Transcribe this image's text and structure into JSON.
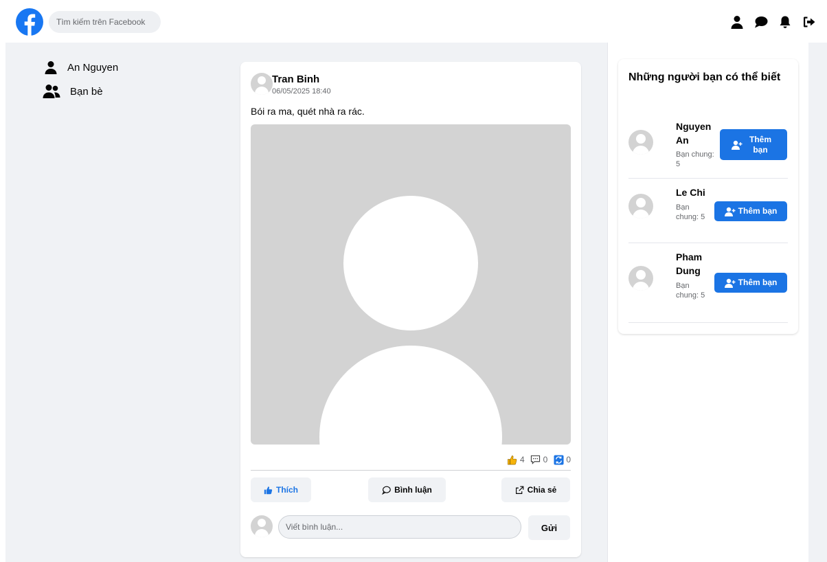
{
  "header": {
    "search_placeholder": "Tìm kiếm trên Facebook",
    "icons": [
      "profile-icon",
      "messenger-icon",
      "bell-icon",
      "logout-icon"
    ],
    "brand_color": "#1877f2"
  },
  "sidebar": {
    "items": [
      {
        "label": "An Nguyen",
        "icon": "user-icon"
      },
      {
        "label": "Bạn bè",
        "icon": "friends-icon"
      }
    ]
  },
  "post": {
    "author": "Tran Binh",
    "time": "06/05/2025 18:40",
    "text": "Bói ra ma, quét nhà ra rác.",
    "likes": "4",
    "comments": "0",
    "shares": "0",
    "like_label": "Thích",
    "comment_label": "Bình luận",
    "share_label": "Chia sẻ",
    "comment_placeholder": "Viết bình luận...",
    "send_label": "Gửi"
  },
  "suggestions": {
    "title": "Những người bạn có thể biết",
    "add_label": "Thêm bạn",
    "people": [
      {
        "name": "Nguyen An",
        "mutual": "Bạn chung: 5"
      },
      {
        "name": "Le Chi",
        "mutual": "Bạn chung: 5"
      },
      {
        "name": "Pham Dung",
        "mutual": "Bạn chung: 5"
      }
    ]
  },
  "colors": {
    "accent": "#1b74e4",
    "background": "#f0f2f5",
    "placeholder_gray": "#d3d3d3"
  }
}
